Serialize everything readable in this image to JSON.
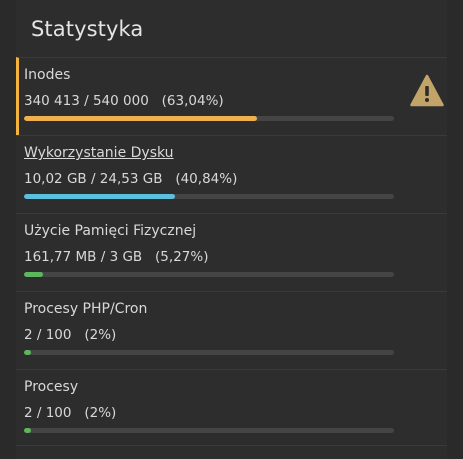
{
  "panel": {
    "title": "Statystyka"
  },
  "stats": [
    {
      "label": "Inodes",
      "value": "340 413 / 540 000   (63,04%)",
      "percent": 63.04,
      "color": "#f0b04e",
      "warning": true,
      "warning_icon": "warning-triangle-icon",
      "warning_color": "#c3a468"
    },
    {
      "label": "Wykorzystanie Dysku",
      "value": "10,02 GB / 24,53 GB   (40,84%)",
      "percent": 40.84,
      "color": "#5bc0de",
      "link": true
    },
    {
      "label": "Użycie Pamięci Fizycznej",
      "value": "161,77 MB / 3 GB   (5,27%)",
      "percent": 5.27,
      "color": "#5cb85c"
    },
    {
      "label": "Procesy PHP/Cron",
      "value": "2 / 100   (2%)",
      "percent": 2,
      "color": "#5cb85c"
    },
    {
      "label": "Procesy",
      "value": "2 / 100   (2%)",
      "percent": 2,
      "color": "#5cb85c"
    }
  ]
}
